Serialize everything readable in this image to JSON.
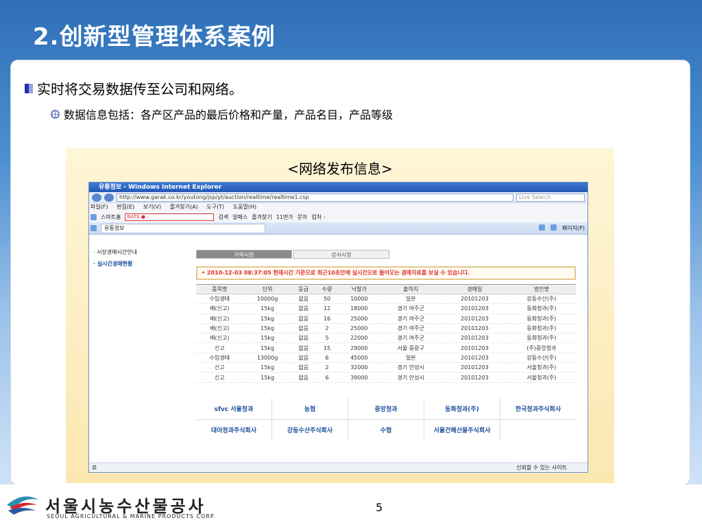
{
  "slide": {
    "title": "2.创新型管理体系案例",
    "bullet1": "实时将交易数据传至公司和网络。",
    "bullet2": "数据信息包括：各产区产品的最后价格和产量，产品名目，产品等级",
    "figure_caption": "<网络发布信息>",
    "page_number": "5"
  },
  "browser": {
    "title": "유통정보 - Windows Internet Explorer",
    "address": "http://www.garak.co.kr/youtong/jsp/yt/auction/realtime/realtime1.csp",
    "search_placeholder": "Live Search",
    "menu": [
      "파일(F)",
      "편집(E)",
      "보기(V)",
      "즐겨찾기(A)",
      "도구(T)",
      "도움말(H)"
    ],
    "toolbar": {
      "smarthome": "스마트홈",
      "nate": "NATE ● -",
      "search_btn": "검색",
      "items": [
        "알패스",
        "즐겨찾기",
        "11번가",
        "문자",
        "컴처 -"
      ]
    },
    "tab": "유통정보",
    "right_tools": [
      "페이지(P)"
    ],
    "sidebar": [
      "· 시장경매시간안내",
      "· 실시간경매현황"
    ],
    "tabs": [
      "가락시장",
      "강서시장"
    ],
    "notice": "• 2010-12-03 08:37:05 현재시간 기준으로 최근10초안에 실시간으로 들어오는 경매자료를 보실 수 있습니다.",
    "status_left": "료",
    "status_right": "신뢰할 수 있는 사이트"
  },
  "table": {
    "headers": [
      "품목명",
      "단위",
      "등급",
      "수량",
      "낙찰가",
      "출하지",
      "경매일",
      "법인명"
    ],
    "rows": [
      [
        "수입생태",
        "10000g",
        "없음",
        "50",
        "10000",
        "일본",
        "20101203",
        "강동수산(주)"
      ],
      [
        "배(신고)",
        "15kg",
        "없음",
        "12",
        "18000",
        "경기 여주군",
        "20101203",
        "동화청과(주)"
      ],
      [
        "배(신고)",
        "15kg",
        "없음",
        "16",
        "25000",
        "경기 여주군",
        "20101203",
        "동화청과(주)"
      ],
      [
        "배(신고)",
        "15kg",
        "없음",
        "2",
        "25000",
        "경기 여주군",
        "20101203",
        "동화청과(주)"
      ],
      [
        "배(신고)",
        "15kg",
        "없음",
        "5",
        "22000",
        "경기 여주군",
        "20101203",
        "동화청과(주)"
      ],
      [
        "신고",
        "15kg",
        "없음",
        "15",
        "29000",
        "서울 중랑구",
        "20101203",
        "(주)중앙청과"
      ],
      [
        "수입생태",
        "13000g",
        "없음",
        "6",
        "45000",
        "일본",
        "20101203",
        "강동수산(주)"
      ],
      [
        "신고",
        "15kg",
        "없음",
        "2",
        "32000",
        "경기 안성시",
        "20101203",
        "서울청과(주)"
      ],
      [
        "신고",
        "15kg",
        "없음",
        "6",
        "39000",
        "경기 안성시",
        "20101203",
        "서울청과(주)"
      ]
    ]
  },
  "logos": [
    "sfvc 서울청과",
    "농협",
    "중앙청과",
    "동화청과(주)",
    "한국청과주식회사",
    "대아청과주식회사",
    "강동수산주식회사",
    "수협",
    "서울건해산물주식회사",
    ""
  ],
  "footer": {
    "org_kr": "서울시농수산물공사",
    "org_en": "SEOUL AGRICULTURAL & MARINE PRODUCTS CORP."
  },
  "colors": {
    "background_top": "#2f6fb7",
    "notice": "#dd3333",
    "browser_title": "#2559b5"
  }
}
